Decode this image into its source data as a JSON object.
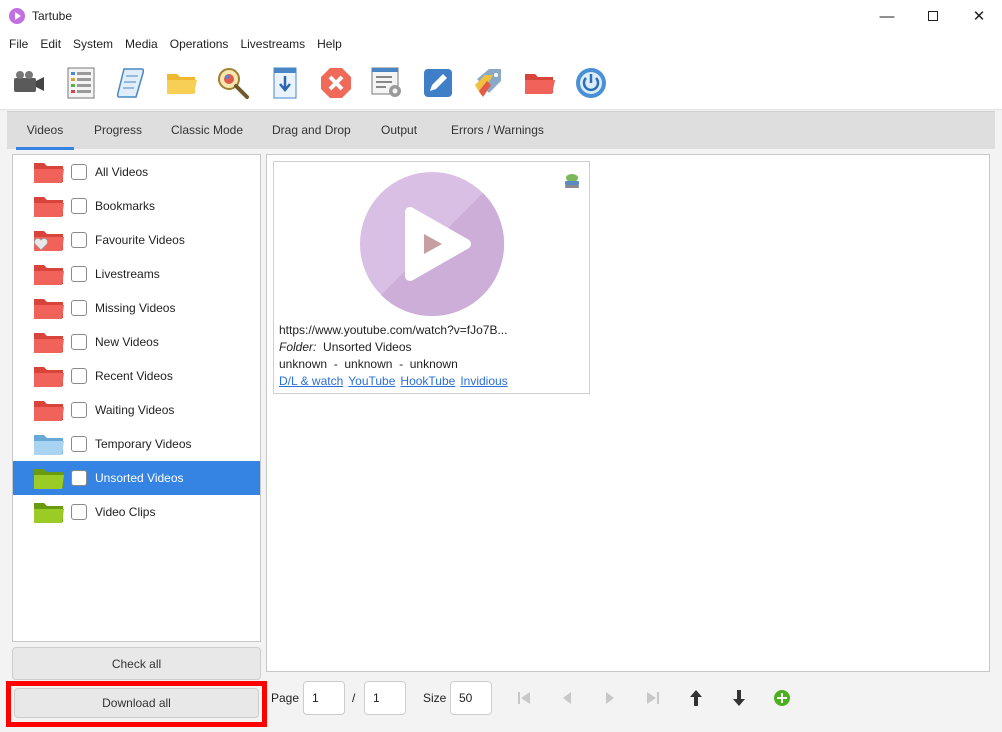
{
  "window": {
    "title": "Tartube",
    "controls": [
      "minimize",
      "maximize",
      "close"
    ]
  },
  "menu": [
    "File",
    "Edit",
    "System",
    "Media",
    "Operations",
    "Livestreams",
    "Help"
  ],
  "toolbar_icons": [
    "camera-icon",
    "list-icon",
    "scroll-icon",
    "folder-open-icon",
    "search-icon",
    "download-icon",
    "stop-icon",
    "settings-list-icon",
    "edit-icon",
    "tags-icon",
    "folder-red-icon",
    "power-icon"
  ],
  "tabs": [
    "Videos",
    "Progress",
    "Classic Mode",
    "Drag and Drop",
    "Output",
    "Errors / Warnings"
  ],
  "active_tab": "Videos",
  "folders": [
    {
      "label": "All Videos",
      "color": "#ee5a50"
    },
    {
      "label": "Bookmarks",
      "color": "#ee5a50"
    },
    {
      "label": "Favourite Videos",
      "color": "#ee5a50"
    },
    {
      "label": "Livestreams",
      "color": "#ee5a50"
    },
    {
      "label": "Missing Videos",
      "color": "#ee5a50"
    },
    {
      "label": "New Videos",
      "color": "#ee5a50"
    },
    {
      "label": "Recent Videos",
      "color": "#ee5a50"
    },
    {
      "label": "Waiting Videos",
      "color": "#ee5a50"
    },
    {
      "label": "Temporary Videos",
      "color": "#8cc4ea"
    },
    {
      "label": "Unsorted Videos",
      "color": "#8fc31f",
      "selected": true
    },
    {
      "label": "Video Clips",
      "color": "#8fc31f"
    }
  ],
  "buttons": {
    "check_all": "Check all",
    "download_all": "Download all"
  },
  "video": {
    "url": "https://www.youtube.com/watch?v=fJo7B...",
    "folder_label": "Folder:",
    "folder_value": "Unsorted Videos",
    "meta": "unknown  -  unknown  -  unknown",
    "links": [
      "D/L & watch",
      "YouTube",
      "HookTube",
      "Invidious"
    ]
  },
  "pagination": {
    "page_label": "Page",
    "page_value": "1",
    "separator": "/",
    "total_pages": "1",
    "size_label": "Size",
    "size_value": "50"
  }
}
